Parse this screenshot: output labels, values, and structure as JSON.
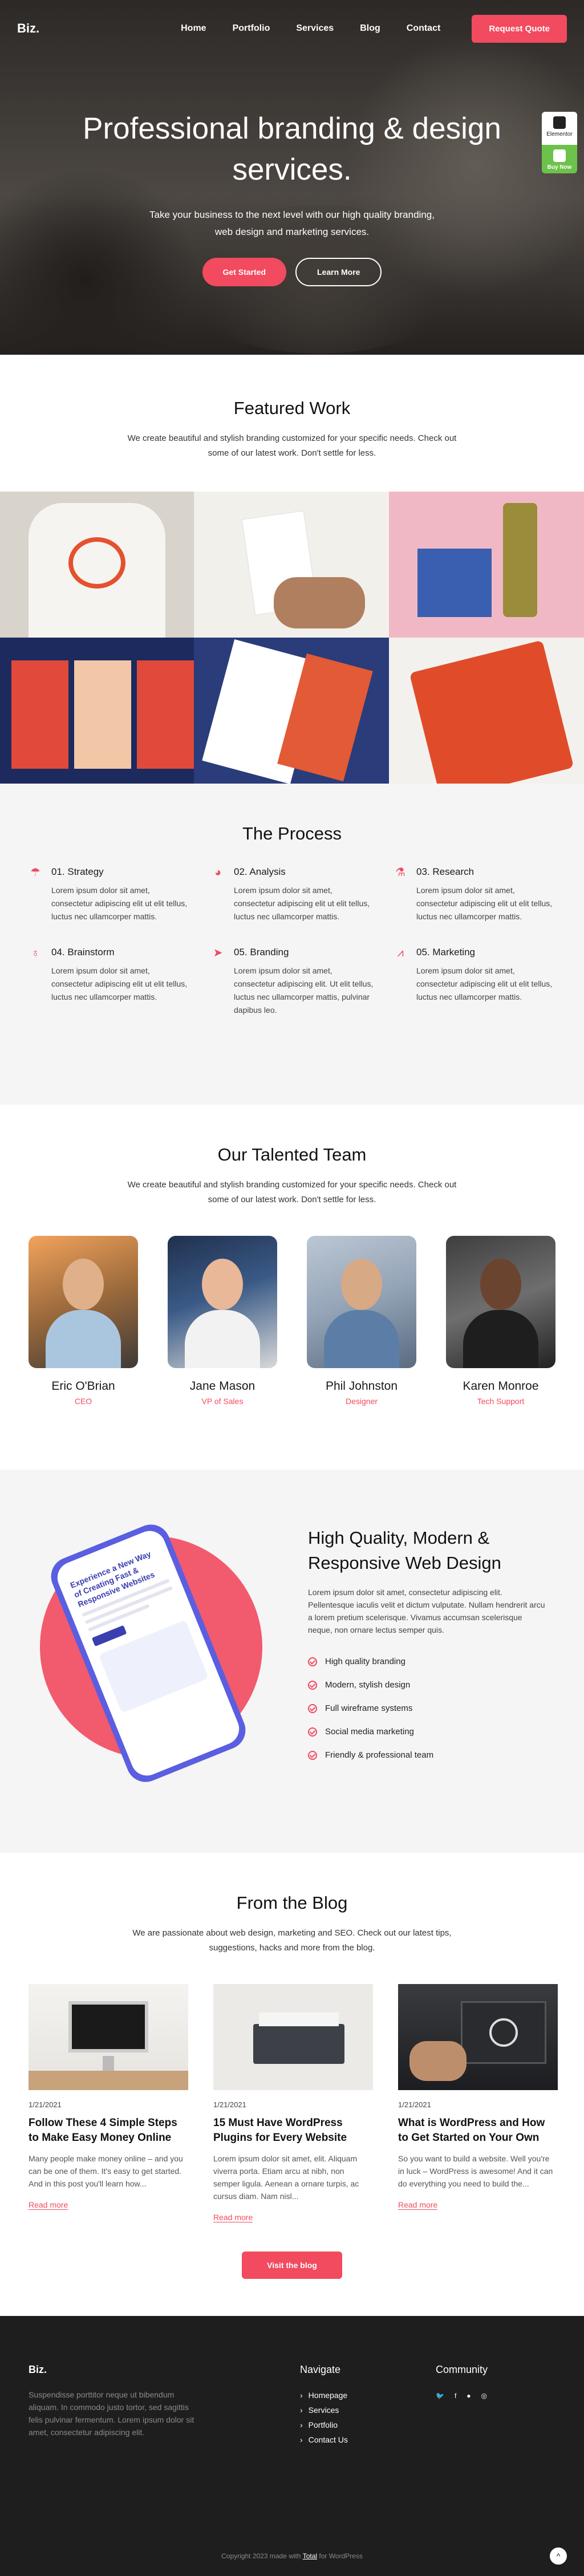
{
  "nav": {
    "logo": "Biz.",
    "links": [
      "Home",
      "Portfolio",
      "Services",
      "Blog",
      "Contact"
    ],
    "cta": "Request Quote"
  },
  "hero": {
    "title": "Professional branding & design services.",
    "subtitle": "Take your business to the next level with our high quality branding, web design and marketing services.",
    "primary_btn": "Get Started",
    "secondary_btn": "Learn More"
  },
  "widget": {
    "elementor_label": "Elementor",
    "buy_label": "Buy Now"
  },
  "featured": {
    "title": "Featured Work",
    "subtitle": "We create beautiful and stylish branding customized for your specific needs. Check out some of our latest work. Don't settle for less."
  },
  "process": {
    "title": "The Process",
    "steps": [
      {
        "title": "01. Strategy",
        "text": "Lorem ipsum dolor sit amet, consectetur adipiscing elit ut elit tellus, luctus nec ullamcorper mattis.",
        "icon": "umbrella-icon"
      },
      {
        "title": "02. Analysis",
        "text": "Lorem ipsum dolor sit amet, consectetur adipiscing elit ut elit tellus, luctus nec ullamcorper mattis.",
        "icon": "pie-chart-icon"
      },
      {
        "title": "03. Research",
        "text": "Lorem ipsum dolor sit amet, consectetur adipiscing elit ut elit tellus, luctus nec ullamcorper mattis.",
        "icon": "flask-icon"
      },
      {
        "title": "04. Brainstorm",
        "text": "Lorem ipsum dolor sit amet, consectetur adipiscing elit ut elit tellus, luctus nec ullamcorper mattis.",
        "icon": "lightbulb-icon"
      },
      {
        "title": "05. Branding",
        "text": "Lorem ipsum dolor sit amet, consectetur adipiscing elit. Ut elit tellus, luctus nec ullamcorper mattis, pulvinar dapibus leo.",
        "icon": "paper-plane-icon"
      },
      {
        "title": "05. Marketing",
        "text": "Lorem ipsum dolor sit amet, consectetur adipiscing elit ut elit tellus, luctus nec ullamcorper mattis.",
        "icon": "chart-line-icon"
      }
    ]
  },
  "team": {
    "title": "Our Talented Team",
    "subtitle": "We create beautiful and stylish branding customized for your specific needs. Check out some of our latest work. Don't settle for less.",
    "members": [
      {
        "name": "Eric O'Brian",
        "role": "CEO"
      },
      {
        "name": "Jane Mason",
        "role": "VP of Sales"
      },
      {
        "name": "Phil Johnston",
        "role": "Designer"
      },
      {
        "name": "Karen Monroe",
        "role": "Tech Support"
      }
    ]
  },
  "quality": {
    "title": "High Quality, Modern & Responsive Web Design",
    "text": "Lorem ipsum dolor sit amet, consectetur adipiscing elit. Pellentesque iaculis velit et dictum vulputate. Nullam hendrerit arcu a lorem pretium scelerisque. Vivamus accumsan scelerisque neque, non ornare lectus semper quis.",
    "features": [
      "High quality branding",
      "Modern, stylish design",
      "Full wireframe systems",
      "Social media marketing",
      "Friendly & professional team"
    ],
    "phone_title": "Experience a New Way of Creating Fast & Responsive Websites"
  },
  "blog": {
    "title": "From the Blog",
    "subtitle": "We are passionate about web design, marketing and SEO. Check out our latest tips, suggestions, hacks and more from the blog.",
    "posts": [
      {
        "date": "1/21/2021",
        "title": "Follow These 4 Simple Steps to Make Easy Money Online",
        "excerpt": "Many people make money online – and you can be one of them. It's easy to get started. And in this post you'll learn how...",
        "more": "Read more"
      },
      {
        "date": "1/21/2021",
        "title": "15 Must Have WordPress Plugins for Every Website",
        "excerpt": "Lorem ipsum dolor sit amet, elit. Aliquam viverra porta. Etiam arcu at nibh, non semper ligula. Aenean a ornare turpis, ac cursus diam. Nam nisl...",
        "more": "Read more"
      },
      {
        "date": "1/21/2021",
        "title": "What is WordPress and How to Get Started on Your Own",
        "excerpt": "So you want to build a website. Well you're in luck – WordPress is awesome! And it can do everything you need to build the...",
        "more": "Read more"
      }
    ],
    "visit_btn": "Visit the blog"
  },
  "footer": {
    "logo": "Biz.",
    "description": "Suspendisse porttitor neque ut bibendum aliquam. In commodo justo tortor, sed sagittis felis pulvinar fermentum. Lorem ipsum dolor sit amet, consectetur adipiscing elit.",
    "navigate_title": "Navigate",
    "nav_links": [
      "Homepage",
      "Services",
      "Portfolio",
      "Contact Us"
    ],
    "community_title": "Community",
    "social_icons": [
      "twitter-icon",
      "facebook-icon",
      "reddit-icon",
      "instagram-icon"
    ],
    "copyright_prefix": "Copyright 2023 made with",
    "copyright_brand": "Total",
    "copyright_suffix": "for WordPress"
  },
  "colors": {
    "accent": "#f24a5e",
    "dark": "#1e1e1e",
    "light_bg": "#f5f5f5"
  }
}
